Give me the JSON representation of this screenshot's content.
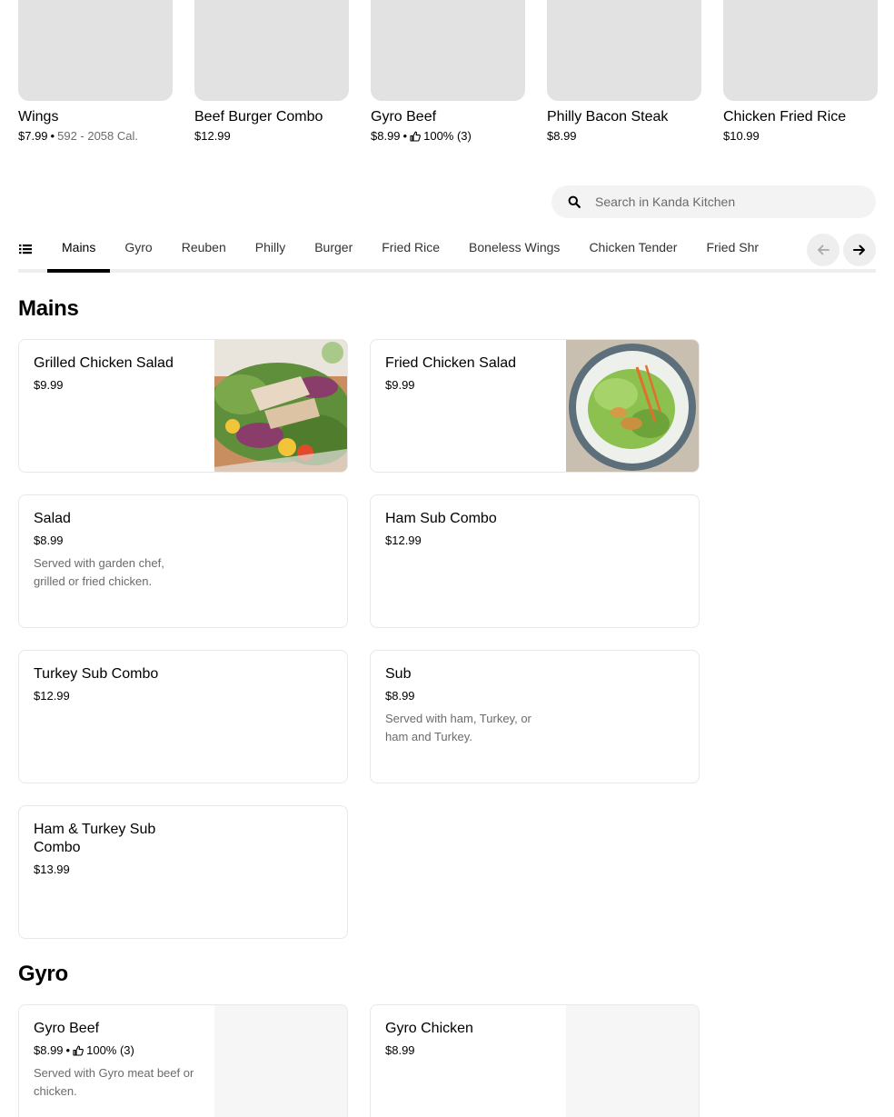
{
  "featured": [
    {
      "name": "Wings",
      "price": "$7.99",
      "sep": "•",
      "calories": "592 - 2058 Cal."
    },
    {
      "name": "Beef Burger Combo",
      "price": "$12.99"
    },
    {
      "name": "Gyro Beef",
      "price": "$8.99",
      "sep": "•",
      "rating": "100% (3)"
    },
    {
      "name": "Philly Bacon Steak",
      "price": "$8.99"
    },
    {
      "name": "Chicken Fried Rice",
      "price": "$10.99"
    }
  ],
  "search": {
    "placeholder": "Search in Kanda Kitchen",
    "icon": "search-icon"
  },
  "tabs": {
    "items": [
      "Mains",
      "Gyro",
      "Reuben",
      "Philly",
      "Burger",
      "Fried Rice",
      "Boneless Wings",
      "Chicken Tender",
      "Fried Shr"
    ],
    "active": "Mains",
    "prev_icon": "arrow-left-icon",
    "next_icon": "arrow-right-icon",
    "list_icon": "menu-list-icon"
  },
  "sections": {
    "mains": {
      "title": "Mains",
      "items": [
        {
          "name": "Grilled Chicken Salad",
          "price": "$9.99"
        },
        {
          "name": "Fried Chicken Salad",
          "price": "$9.99"
        },
        {
          "name": "Salad",
          "price": "$8.99",
          "desc": "Served with garden chef, grilled or fried chicken."
        },
        {
          "name": "Ham Sub Combo",
          "price": "$12.99"
        },
        {
          "name": "Turkey Sub Combo",
          "price": "$12.99"
        },
        {
          "name": "Sub",
          "price": "$8.99",
          "desc": "Served with ham, Turkey, or ham and Turkey."
        },
        {
          "name": "Ham & Turkey Sub Combo",
          "price": "$13.99"
        }
      ]
    },
    "gyro": {
      "title": "Gyro",
      "items": [
        {
          "name": "Gyro Beef",
          "price": "$8.99",
          "sep": "•",
          "rating": "100% (3)",
          "desc": "Served with Gyro meat beef or chicken."
        },
        {
          "name": "Gyro Chicken",
          "price": "$8.99"
        }
      ]
    }
  },
  "colors": {
    "accent": "#000000",
    "muted": "#6b6b6b",
    "placeholder_bg": "#e2e2e2",
    "card_border": "#e8e8e8"
  }
}
